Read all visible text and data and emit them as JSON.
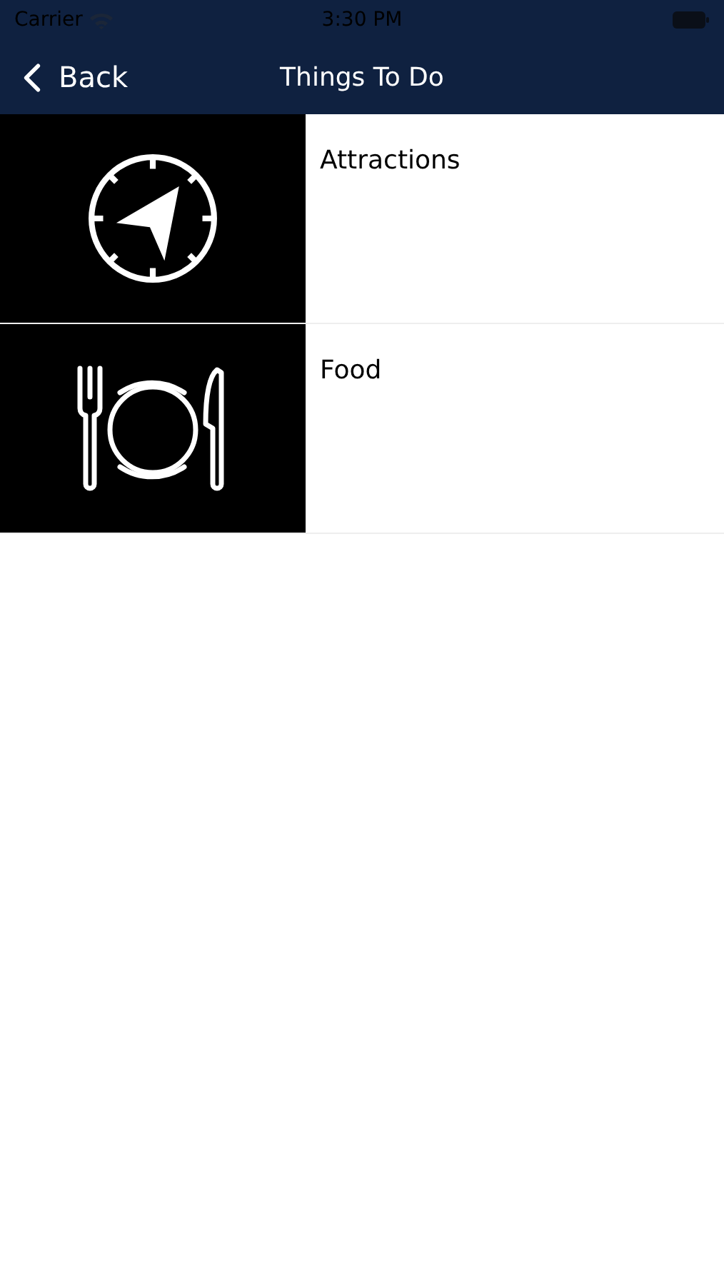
{
  "status_bar": {
    "carrier": "Carrier",
    "time": "3:30 PM"
  },
  "nav_bar": {
    "back": "Back",
    "title": "Things To Do"
  },
  "items": [
    {
      "label": "Attractions",
      "kind": "compass"
    },
    {
      "label": "Food",
      "kind": "dining"
    }
  ]
}
